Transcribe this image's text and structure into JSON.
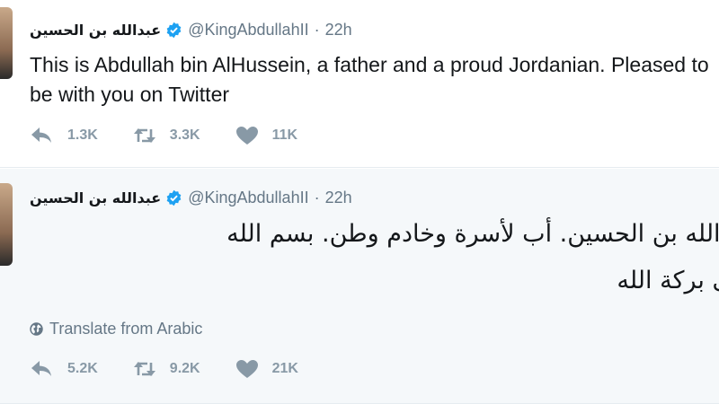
{
  "tweets": [
    {
      "author_name": "عبدالله بن الحسين",
      "handle": "@KingAbdullahII",
      "separator": "·",
      "time": "22h",
      "text": "This is Abdullah bin AlHussein, a father and a proud Jordanian. Pleased to be with you on Twitter",
      "replies": "1.3K",
      "retweets": "3.3K",
      "likes": "11K"
    },
    {
      "author_name": "عبدالله بن الحسين",
      "handle": "@KingAbdullahII",
      "separator": "·",
      "time": "22h",
      "text": "عبدالله بن الحسين. أب لأسرة وخادم وطن. بسم الله\nعلى بركة الله",
      "translate_label": "Translate from Arabic",
      "replies": "5.2K",
      "retweets": "9.2K",
      "likes": "21K"
    }
  ],
  "colors": {
    "verified": "#1da1f2",
    "icon_gray": "#8899a6",
    "meta_gray": "#657786",
    "highlight_bg": "#f5f8fa"
  },
  "icons": [
    "verified-badge-icon",
    "reply-icon",
    "retweet-icon",
    "heart-icon",
    "globe-icon"
  ]
}
